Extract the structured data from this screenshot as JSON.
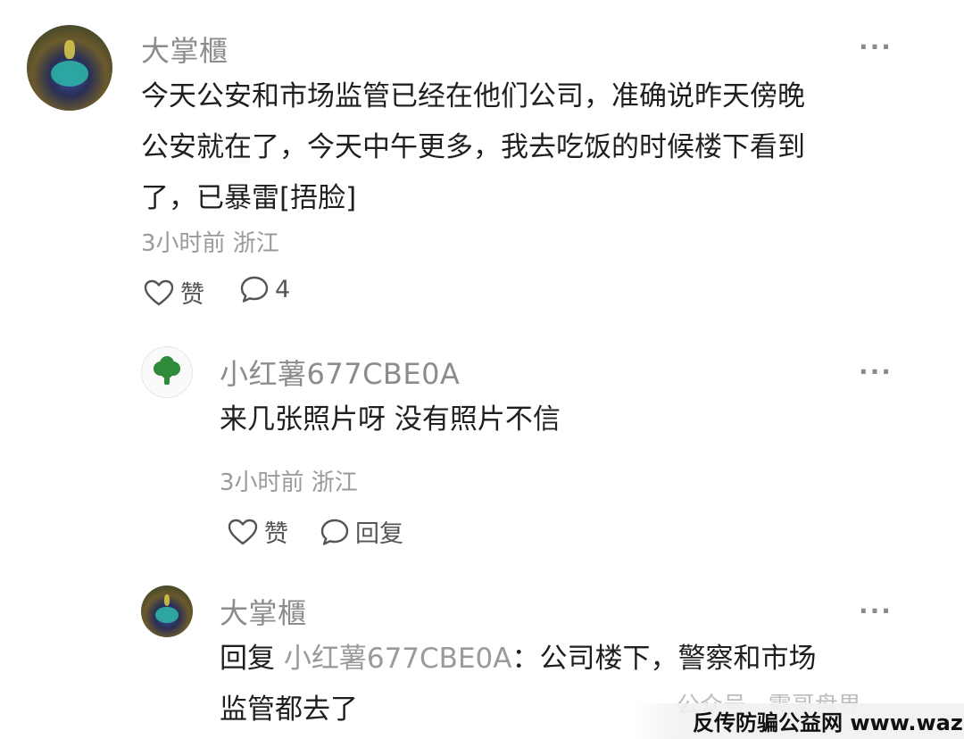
{
  "comments": [
    {
      "author": "大掌櫃",
      "more": "···",
      "lines": [
        "今天公安和市场监管已经在他们公司，准确说昨天傍晚",
        "公安就在了，今天中午更多，我去吃饭的时候楼下看到",
        "了，已暴雷[捂脸]"
      ],
      "time_location": "3小时前 浙江",
      "like_label": "赞",
      "reply_count": "4"
    },
    {
      "author": "小红薯677CBE0A",
      "more": "···",
      "lines": [
        "来几张照片呀 没有照片不信"
      ],
      "time_location": "3小时前 浙江",
      "like_label": "赞",
      "reply_label": "回复"
    },
    {
      "author": "大掌櫃",
      "more": "···",
      "reply_prefix": "回复",
      "reply_to": "小红薯677CBE0A",
      "reply_colon": "：公司楼下，警察和市场",
      "line2": "监管都去了"
    }
  ],
  "watermark": {
    "gray_text": "公众号 · 震哥盘界",
    "main_text": "反传防骗公益网 www.wazi.cc"
  },
  "colors": {
    "name": "#8c8c8c",
    "text": "#1f1f1f",
    "meta": "#9a9a9a",
    "avatar_green": "#2e8b3a"
  },
  "icons": {
    "like": "heart-outline-icon",
    "reply": "speech-bubble-icon",
    "more": "ellipsis-icon"
  }
}
